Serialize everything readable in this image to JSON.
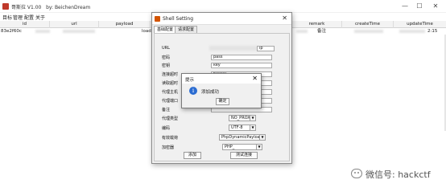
{
  "app": {
    "title": "哥斯拉 V1.00   by: BeichenDream",
    "window_controls": [
      "—",
      "☐",
      "✕"
    ]
  },
  "menu": [
    "目标",
    "管理",
    "配置",
    "关于"
  ],
  "table": {
    "columns": [
      "id",
      "url",
      "payload",
      "remark",
      "createTime",
      "updateTime"
    ],
    "row": {
      "id": "83e2f60c",
      "payload": "load",
      "remark": "备注",
      "updateTime": "2:15"
    }
  },
  "shell_setting": {
    "title": "Shell Setting",
    "close": "✕",
    "tabs": [
      "基础配置",
      "请求配置"
    ],
    "fields": [
      {
        "label": "URL",
        "value": "ip"
      },
      {
        "label": "密码",
        "value": "pass"
      },
      {
        "label": "密钥",
        "value": "key"
      },
      {
        "label": "连接超时",
        "value": "60000"
      },
      {
        "label": "读取超时",
        "value": ""
      },
      {
        "label": "代理主机",
        "value": ""
      },
      {
        "label": "代理端口",
        "value": ""
      },
      {
        "label": "备注",
        "value": ""
      }
    ],
    "selects": [
      {
        "label": "代理类型",
        "value": "NO_PROXY"
      },
      {
        "label": "编码",
        "value": "UTF-8"
      },
      {
        "label": "有效载荷",
        "value": "PhpDynamicPayload"
      },
      {
        "label": "加密器",
        "value": "PHP_"
      }
    ],
    "buttons": {
      "add": "添加",
      "test": "测试连接"
    }
  },
  "prompt": {
    "title": "提示",
    "close": "✕",
    "icon": "info-icon",
    "message": "添加成功",
    "ok": "确定"
  },
  "watermark": {
    "text": "微信号: hackctf"
  }
}
